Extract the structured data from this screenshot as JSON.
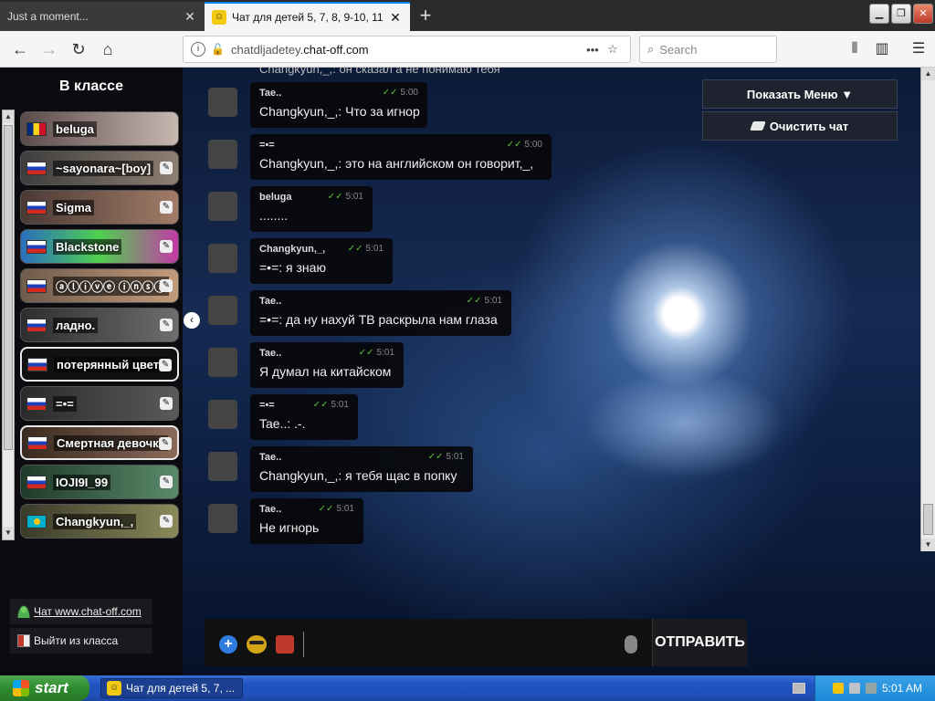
{
  "browser": {
    "tabs": [
      {
        "title": "Just a moment...",
        "active": false
      },
      {
        "title": "Чат для детей 5, 7, 8, 9-10, 11",
        "active": true
      }
    ],
    "url_host": "chatdljadetey.",
    "url_domain": "chat-off.com",
    "search_placeholder": "Search"
  },
  "left_panel": {
    "title": "В классе",
    "users": [
      {
        "name": "beluga",
        "flag": "ro",
        "pm": false
      },
      {
        "name": "~sayonara~[boy]",
        "flag": "ru",
        "pm": true
      },
      {
        "name": "Sigma",
        "flag": "ru",
        "pm": true
      },
      {
        "name": "Blackstone",
        "flag": "ru",
        "pm": true
      },
      {
        "name": "ⓐⓛⓘⓥⓔ ⓘⓝⓢⓘ",
        "flag": "ru",
        "pm": true
      },
      {
        "name": "ладно.",
        "flag": "ru",
        "pm": true
      },
      {
        "name": "потерянный цвет ок",
        "flag": "ru",
        "pm": true,
        "selected": true
      },
      {
        "name": "=•=",
        "flag": "ru",
        "pm": true
      },
      {
        "name": "Смертная девочка",
        "flag": "ru",
        "pm": true
      },
      {
        "name": "IOJI9I_99",
        "flag": "ru",
        "pm": true
      },
      {
        "name": "Changkyun,_,",
        "flag": "kz",
        "pm": true
      }
    ],
    "site_link": "Чат www.chat-off.com",
    "exit_link": "Выйти из класса"
  },
  "top_buttons": {
    "menu": "Показать Меню ▼",
    "clear": "Очистить чат"
  },
  "messages": {
    "partial_top": "Changkyun,_,: он сказал а не понимаю тебя",
    "items": [
      {
        "sender": "Tae..",
        "time": "5:00",
        "text": "Changkyun,_,: Что за игнор",
        "avatar": "tae"
      },
      {
        "sender": "=•=",
        "time": "5:00",
        "text": "Changkyun,_,: это на английском он говорит,_,",
        "avatar": "eq"
      },
      {
        "sender": "beluga",
        "time": "5:01",
        "text": "........",
        "avatar": "cat"
      },
      {
        "sender": "Changkyun,_,",
        "time": "5:01",
        "text": "=•=: я знаю",
        "avatar": "ck"
      },
      {
        "sender": "Tae..",
        "time": "5:01",
        "text": "=•=: да ну нахуй ТВ раскрыла нам глаза",
        "avatar": "tae"
      },
      {
        "sender": "Tae..",
        "time": "5:01",
        "text": "Я думал на китайском",
        "avatar": "tae"
      },
      {
        "sender": "=•=",
        "time": "5:01",
        "text": "Tae..: .-.",
        "avatar": "eq"
      },
      {
        "sender": "Tae..",
        "time": "5:01",
        "text": "Changkyun,_,: я тебя щас в попку",
        "avatar": "tae"
      },
      {
        "sender": "Tae..",
        "time": "5:01",
        "text": "Не игнорь",
        "avatar": "tae"
      }
    ]
  },
  "input": {
    "value": "",
    "send_label": "ОТПРАВИТЬ"
  },
  "taskbar": {
    "start_label": "start",
    "task_label": "Чат для детей 5, 7, ...",
    "clock": "5:01 AM"
  },
  "colors": {
    "accent_check": "#5fbf3b",
    "send_bg": "#1b1b1f",
    "xp_start": "#2e8b2e",
    "xp_taskbar": "#2256c5"
  }
}
